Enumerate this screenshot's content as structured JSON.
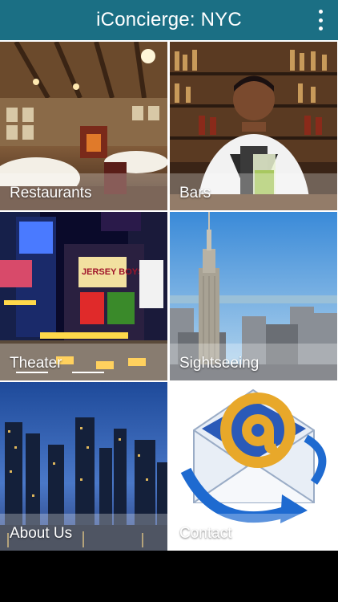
{
  "app": {
    "title": "iConcierge: NYC",
    "menu_icon": "more-vert-icon",
    "accent_color": "#1b6f84"
  },
  "tiles": [
    {
      "label": "Restaurants",
      "icon": "restaurant-photo"
    },
    {
      "label": "Bars",
      "icon": "bartender-photo"
    },
    {
      "label": "Theater",
      "icon": "times-square-photo"
    },
    {
      "label": "Sightseeing",
      "icon": "empire-state-photo"
    },
    {
      "label": "About Us",
      "icon": "skyline-night-photo"
    },
    {
      "label": "Contact",
      "icon": "email-envelope-icon"
    }
  ]
}
